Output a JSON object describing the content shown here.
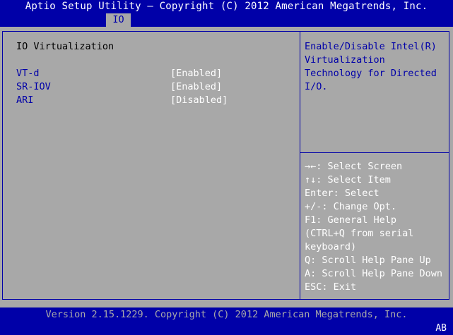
{
  "header": {
    "title": "Aptio Setup Utility – Copyright (C) 2012 American Megatrends, Inc.",
    "tab": "IO"
  },
  "section": {
    "title": "IO Virtualization"
  },
  "options": [
    {
      "label": "VT-d",
      "value": "[Enabled]"
    },
    {
      "label": "SR-IOV",
      "value": "[Enabled]"
    },
    {
      "label": "ARI",
      "value": "[Disabled]"
    }
  ],
  "help": {
    "description": "Enable/Disable Intel(R)\nVirtualization\nTechnology for Directed\nI/O."
  },
  "keys": [
    "→←: Select Screen",
    "↑↓: Select Item",
    "Enter: Select",
    "+/-: Change Opt.",
    "F1: General Help",
    "(CTRL+Q from serial",
    "keyboard)",
    "Q: Scroll Help Pane Up",
    "A: Scroll Help Pane Down",
    "ESC: Exit"
  ],
  "footer": {
    "version": "Version 2.15.1229. Copyright (C) 2012 American Megatrends, Inc.",
    "badge": "AB"
  },
  "colors": {
    "background": "#0000a8",
    "panel": "#a8a8a8",
    "highlight": "#ffffff",
    "text_blue": "#0000a8",
    "text_black": "#000000"
  }
}
